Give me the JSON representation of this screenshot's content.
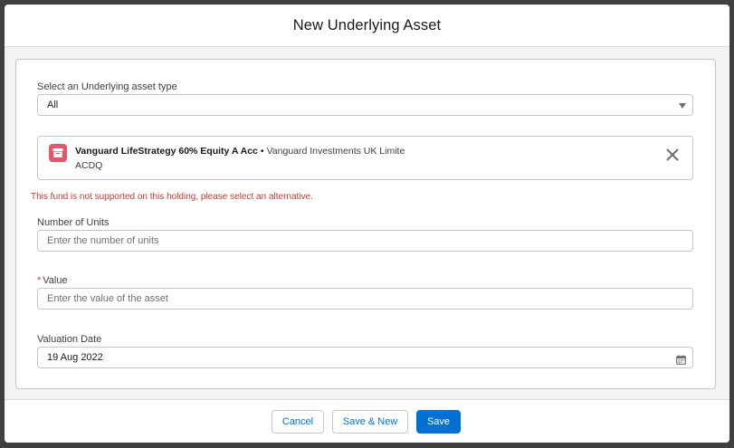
{
  "modal": {
    "title": "New Underlying Asset"
  },
  "form": {
    "asset_type": {
      "label": "Select an Underlying asset type",
      "value": "All"
    },
    "selected_fund": {
      "name": "Vanguard LifeStrategy 60% Equity A Acc",
      "separator": "•",
      "provider": "Vanguard Investments UK Limite",
      "code": "ACDQ",
      "icon": "archive-icon",
      "icon_color": "#e3566b"
    },
    "error": "This fund is not supported on this holding, please select an alternative.",
    "units": {
      "label": "Number of Units",
      "placeholder": "Enter the number of units"
    },
    "value": {
      "required_marker": "*",
      "label": "Value",
      "placeholder": "Enter the value of the asset"
    },
    "valuation_date": {
      "label": "Valuation Date",
      "value": "19 Aug 2022"
    }
  },
  "footer": {
    "cancel_label": "Cancel",
    "save_new_label": "Save & New",
    "save_label": "Save"
  },
  "colors": {
    "brand": "#0070d2",
    "error": "#c23934"
  }
}
